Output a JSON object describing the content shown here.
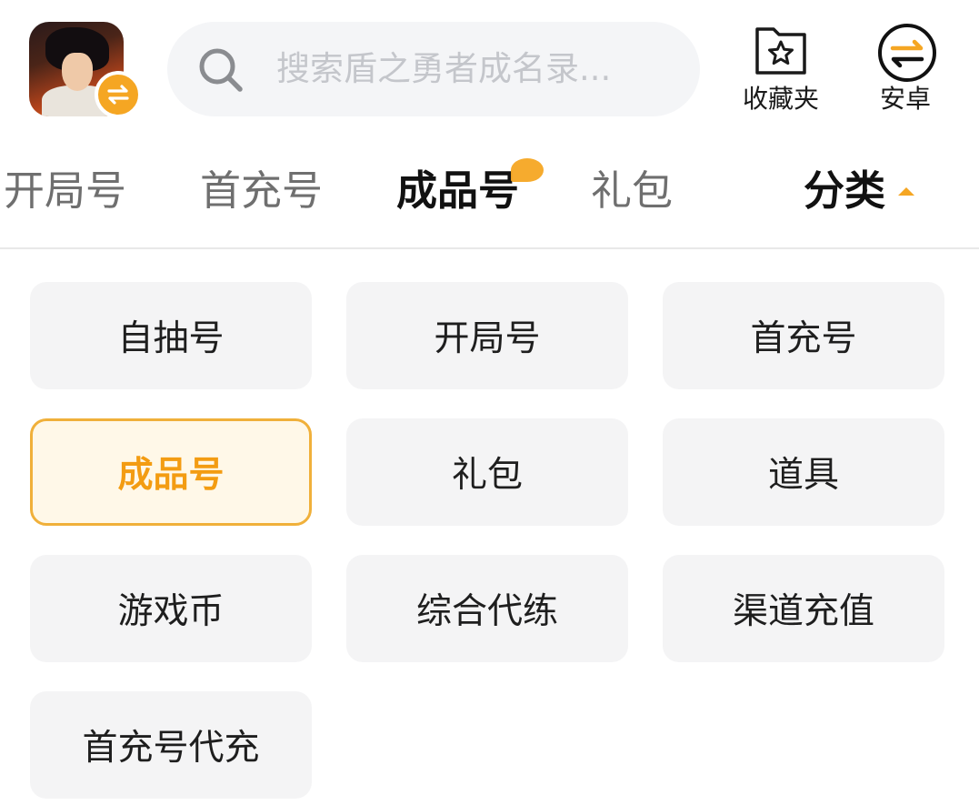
{
  "header": {
    "search_placeholder": "搜索盾之勇者成名录...",
    "actions": [
      {
        "label": "收藏夹",
        "icon": "star-folder-icon"
      },
      {
        "label": "安卓",
        "icon": "swap-arrows-circle-icon"
      }
    ]
  },
  "tabs": [
    {
      "label": "开局号",
      "active": false
    },
    {
      "label": "首充号",
      "active": false
    },
    {
      "label": "成品号",
      "active": true
    },
    {
      "label": "礼包",
      "active": false
    }
  ],
  "category_toggle": {
    "label": "分类",
    "icon": "caret-up-icon"
  },
  "categories": [
    {
      "label": "自抽号",
      "selected": false
    },
    {
      "label": "开局号",
      "selected": false
    },
    {
      "label": "首充号",
      "selected": false
    },
    {
      "label": "成品号",
      "selected": true
    },
    {
      "label": "礼包",
      "selected": false
    },
    {
      "label": "道具",
      "selected": false
    },
    {
      "label": "游戏币",
      "selected": false
    },
    {
      "label": "综合代练",
      "selected": false
    },
    {
      "label": "渠道充值",
      "selected": false
    },
    {
      "label": "首充号代充",
      "selected": false
    }
  ],
  "colors": {
    "accent": "#f5a623",
    "selected_text": "#f39c12",
    "chip_bg": "#f4f4f5",
    "search_bg": "#f4f5f7"
  }
}
